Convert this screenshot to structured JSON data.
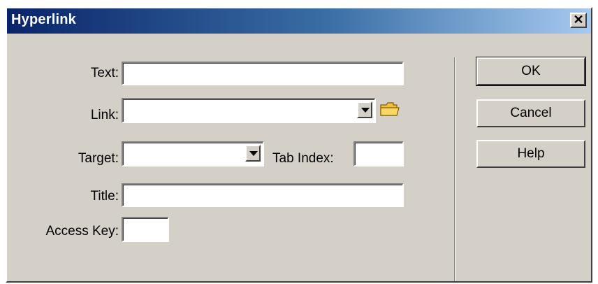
{
  "window": {
    "title": "Hyperlink",
    "close_glyph": "✕"
  },
  "form": {
    "text_label": "Text:",
    "text_value": "",
    "link_label": "Link:",
    "link_value": "",
    "target_label": "Target:",
    "target_value": "",
    "tab_index_label": "Tab Index:",
    "tab_index_value": "",
    "title_label": "Title:",
    "title_value": "",
    "access_key_label": "Access Key:",
    "access_key_value": ""
  },
  "buttons": {
    "ok": "OK",
    "cancel": "Cancel",
    "help": "Help"
  },
  "icons": {
    "browse": "folder-icon",
    "dropdown": "chevron-down-icon"
  },
  "colors": {
    "dialog_bg": "#d4d0c8",
    "title_start": "#0a246a",
    "title_end": "#a6caf0",
    "folder": "#f0c040"
  }
}
